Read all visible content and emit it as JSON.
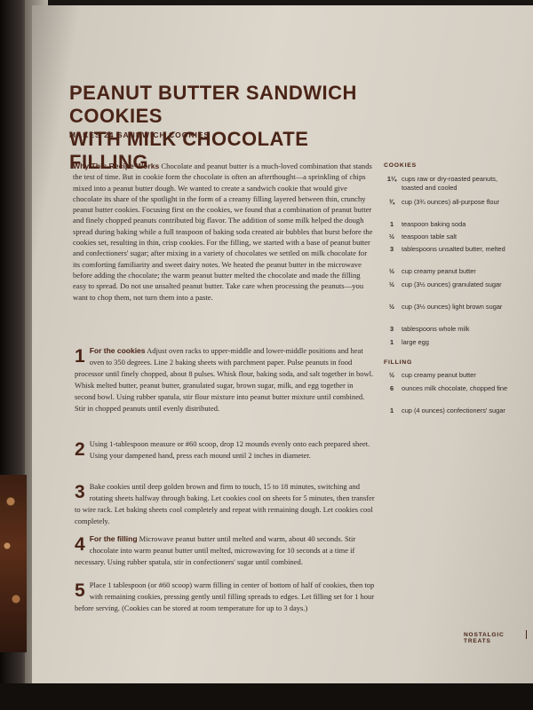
{
  "recipe": {
    "title_line1": "PEANUT BUTTER SANDWICH COOKIES",
    "title_line2": "WITH MILK CHOCOLATE FILLING",
    "yield": "MAKES 24 SANDWICH COOKIES"
  },
  "intro": {
    "lead": "Why This Recipe Works",
    "text": " Chocolate and peanut butter is a much-loved combination that stands the test of time. But in cookie form the chocolate is often an afterthought—a sprinkling of chips mixed into a peanut butter dough. We wanted to create a sandwich cookie that would give chocolate its share of the spotlight in the form of a creamy filling layered between thin, crunchy peanut butter cookies. Focusing first on the cookies, we found that a combination of peanut butter and finely chopped peanuts contributed big flavor. The addition of some milk helped the dough spread during baking while a full teaspoon of baking soda created air bubbles that burst before the cookies set, resulting in thin, crisp cookies. For the filling, we started with a base of peanut butter and confectioners' sugar; after mixing in a variety of chocolates we settled on milk chocolate for its comforting familiarity and sweet dairy notes. We heated the peanut butter in the microwave before adding the chocolate; the warm peanut butter melted the chocolate and made the filling easy to spread. Do not use unsalted peanut butter. Take care when processing the peanuts—you want to chop them, not turn them into a paste."
  },
  "steps": [
    {
      "num": "1",
      "lead": "For the cookies",
      "text": " Adjust oven racks to upper-middle and lower-middle positions and heat oven to 350 degrees. Line 2 baking sheets with parchment paper. Pulse peanuts in food processor until finely chopped, about 8 pulses. Whisk flour, baking soda, and salt together in bowl. Whisk melted butter, peanut butter, granulated sugar, brown sugar, milk, and egg together in second bowl. Using rubber spatula, stir flour mixture into peanut butter mixture until combined. Stir in chopped peanuts until evenly distributed."
    },
    {
      "num": "2",
      "lead": "",
      "text": "Using 1-tablespoon measure or #60 scoop, drop 12 mounds evenly onto each prepared sheet. Using your dampened hand, press each mound until 2 inches in diameter."
    },
    {
      "num": "3",
      "lead": "",
      "text": "Bake cookies until deep golden brown and firm to touch, 15 to 18 minutes, switching and rotating sheets halfway through baking. Let cookies cool on sheets for 5 minutes, then transfer to wire rack. Let baking sheets cool completely and repeat with remaining dough. Let cookies cool completely."
    },
    {
      "num": "4",
      "lead": "For the filling",
      "text": " Microwave peanut butter until melted and warm, about 40 seconds. Stir chocolate into warm peanut butter until melted, microwaving for 10 seconds at a time if necessary. Using rubber spatula, stir in confectioners' sugar until combined."
    },
    {
      "num": "5",
      "lead": "",
      "text": "Place 1 tablespoon (or #60 scoop) warm filling in center of bottom of half of cookies, then top with remaining cookies, pressing gently until filling spreads to edges. Let filling set for 1 hour before serving. (Cookies can be stored at room temperature for up to 3 days.)"
    }
  ],
  "ingredients": {
    "cookies_heading": "COOKIES",
    "cookies": [
      {
        "qty": "1¼",
        "text": "cups raw or dry-roasted peanuts, toasted and cooled"
      },
      {
        "qty": "¾",
        "text": "cup (3¾ ounces) all-purpose flour"
      },
      {
        "qty": "1",
        "text": "teaspoon baking soda"
      },
      {
        "qty": "½",
        "text": "teaspoon table salt"
      },
      {
        "qty": "3",
        "text": "tablespoons unsalted butter, melted"
      },
      {
        "qty": "½",
        "text": "cup creamy peanut butter"
      },
      {
        "qty": "½",
        "text": "cup (3½ ounces) granulated sugar"
      },
      {
        "qty": "½",
        "text": "cup (3½ ounces) light brown sugar"
      },
      {
        "qty": "3",
        "text": "tablespoons whole milk"
      },
      {
        "qty": "1",
        "text": "large egg"
      }
    ],
    "filling_heading": "FILLING",
    "filling": [
      {
        "qty": "½",
        "text": "cup creamy peanut butter"
      },
      {
        "qty": "6",
        "text": "ounces milk chocolate, chopped fine"
      },
      {
        "qty": "1",
        "text": "cup (4 ounces) confectioners' sugar"
      }
    ]
  },
  "footer": {
    "section": "NOSTALGIC TREATS"
  }
}
